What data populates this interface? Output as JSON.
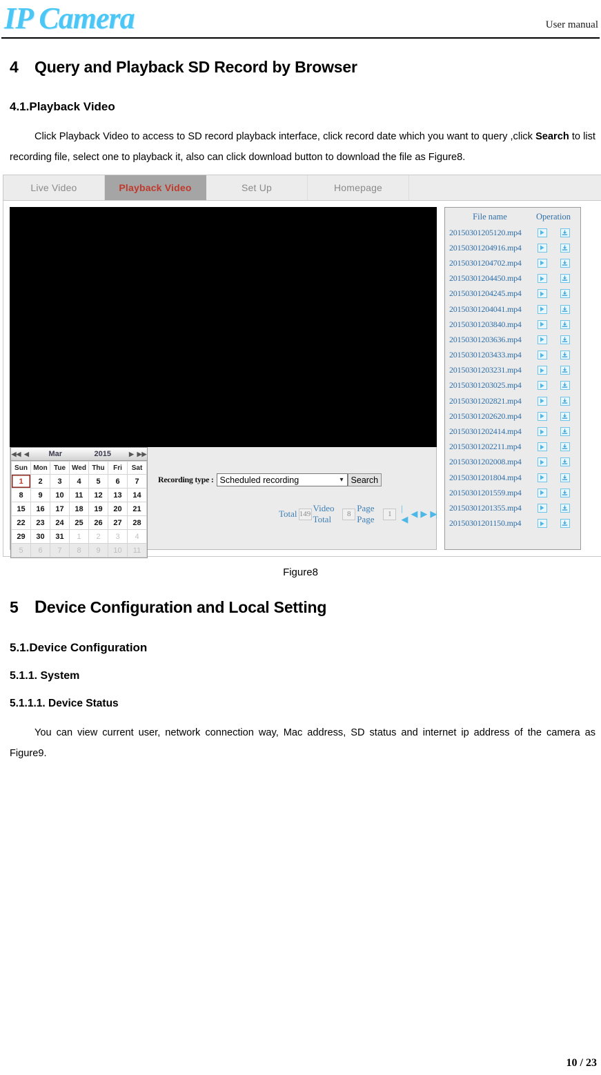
{
  "header": {
    "logo_text": "IP Camera",
    "right_label": "User manual"
  },
  "sections": {
    "s4_num": "4",
    "s4_title": "Query and Playback SD Record by Browser",
    "s41_title": "4.1.Playback Video",
    "p41_indent": "Click Playback Video to access to SD record playback interface, click record date which you want to query ,click ",
    "p41_bold": "Search",
    "p41_rest": " to list recording file, select one to playback it, also can click download button to download the file as Figure8.",
    "figure8_caption": "Figure8",
    "s5_num": "5",
    "s5_title_cap": "D",
    "s5_title_rest": "evice Configuration and Local Setting",
    "s51_title": "5.1.Device Configuration",
    "s511_title": "5.1.1.  System",
    "s5111_title": "5.1.1.1. Device Status",
    "p5111": "You can view current user, network connection way, Mac address, SD status and internet ip address of the camera as Figure9."
  },
  "screenshot": {
    "tabs": [
      {
        "label": "Live Video",
        "active": false
      },
      {
        "label": "Playback Video",
        "active": true
      },
      {
        "label": "Set Up",
        "active": false
      },
      {
        "label": "Homepage",
        "active": false
      }
    ],
    "calendar": {
      "prev_year_icon": "◀◀",
      "prev_month_icon": "◀",
      "month": "Mar",
      "year": "2015",
      "next_month_icon": "▶",
      "next_year_icon": "▶▶",
      "weekdays": [
        "Sun",
        "Mon",
        "Tue",
        "Wed",
        "Thu",
        "Fri",
        "Sat"
      ],
      "selected_day": "1",
      "weeks": [
        [
          {
            "d": "1",
            "s": "sel"
          },
          {
            "d": "2"
          },
          {
            "d": "3"
          },
          {
            "d": "4"
          },
          {
            "d": "5"
          },
          {
            "d": "6"
          },
          {
            "d": "7"
          }
        ],
        [
          {
            "d": "8"
          },
          {
            "d": "9"
          },
          {
            "d": "10"
          },
          {
            "d": "11"
          },
          {
            "d": "12"
          },
          {
            "d": "13"
          },
          {
            "d": "14"
          }
        ],
        [
          {
            "d": "15"
          },
          {
            "d": "16"
          },
          {
            "d": "17"
          },
          {
            "d": "18"
          },
          {
            "d": "19"
          },
          {
            "d": "20"
          },
          {
            "d": "21"
          }
        ],
        [
          {
            "d": "22"
          },
          {
            "d": "23"
          },
          {
            "d": "24"
          },
          {
            "d": "25"
          },
          {
            "d": "26"
          },
          {
            "d": "27"
          },
          {
            "d": "28"
          }
        ],
        [
          {
            "d": "29"
          },
          {
            "d": "30"
          },
          {
            "d": "31"
          },
          {
            "d": "1",
            "s": "dim"
          },
          {
            "d": "2",
            "s": "dim"
          },
          {
            "d": "3",
            "s": "dim"
          },
          {
            "d": "4",
            "s": "dim"
          }
        ],
        [
          {
            "d": "5"
          },
          {
            "d": "6"
          },
          {
            "d": "7"
          },
          {
            "d": "8"
          },
          {
            "d": "9"
          },
          {
            "d": "10"
          },
          {
            "d": "11"
          }
        ]
      ]
    },
    "search": {
      "recording_type_label": "Recording type :",
      "recording_type_value": "Scheduled recording",
      "search_button": "Search"
    },
    "pagination": {
      "total_label": "Total",
      "total_value": "149",
      "video_total_label": "Video Total",
      "video_total_value": "8",
      "page_label": "Page Page",
      "page_value": "1",
      "first_icon": "|◀",
      "prev_icon": "◀",
      "next_icon": "▶",
      "last_icon": "▶|"
    },
    "file_list": {
      "col_name": "File name",
      "col_operation": "Operation",
      "files": [
        "20150301205120.mp4",
        "20150301204916.mp4",
        "20150301204702.mp4",
        "20150301204450.mp4",
        "20150301204245.mp4",
        "20150301204041.mp4",
        "20150301203840.mp4",
        "20150301203636.mp4",
        "20150301203433.mp4",
        "20150301203231.mp4",
        "20150301203025.mp4",
        "20150301202821.mp4",
        "20150301202620.mp4",
        "20150301202414.mp4",
        "20150301202211.mp4",
        "20150301202008.mp4",
        "20150301201804.mp4",
        "20150301201559.mp4",
        "20150301201355.mp4",
        "20150301201150.mp4"
      ]
    }
  },
  "footer": {
    "page_number": "10 / 23"
  },
  "colors": {
    "logo_cyan": "#4cc7f5",
    "active_tab_text": "#c0392b",
    "active_tab_bg": "#a5a5a5",
    "file_text_blue": "#2f6fa8",
    "icon_blue": "#4db8e8",
    "selected_day_red": "#c0392b"
  }
}
